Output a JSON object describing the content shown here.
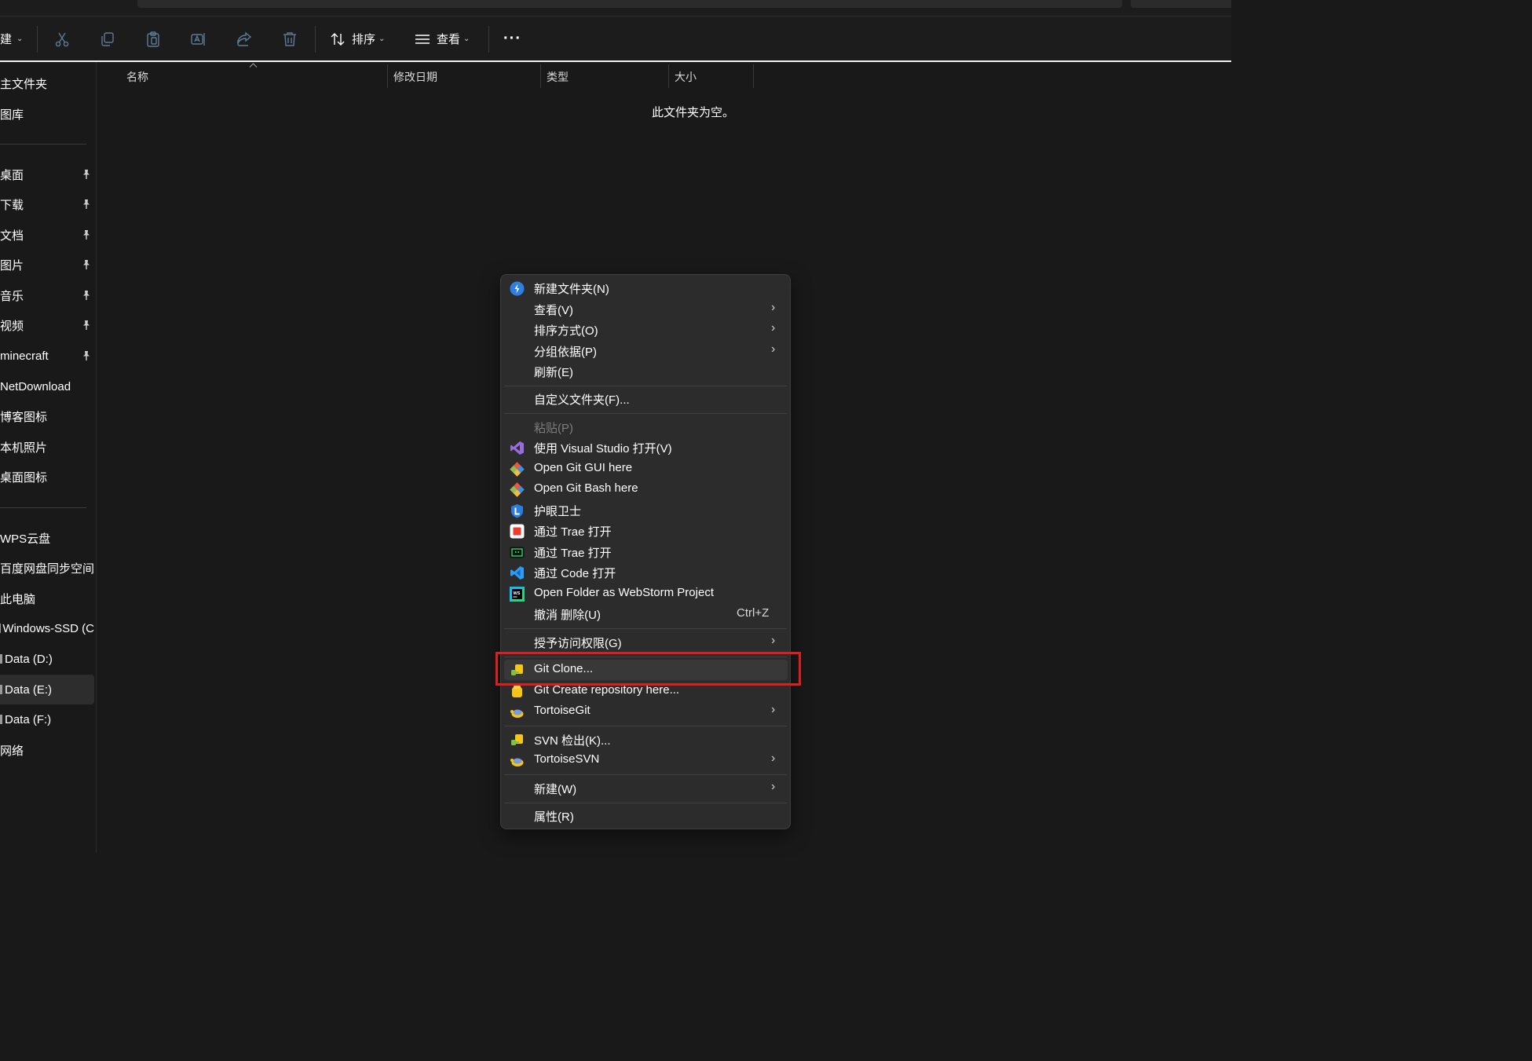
{
  "toolbar": {
    "new_label": "建",
    "sort_label": "排序",
    "view_label": "查看",
    "more_label": "···"
  },
  "columns": [
    "名称",
    "修改日期",
    "类型",
    "大小"
  ],
  "empty_message": "此文件夹为空。",
  "sidebar": {
    "top_items": [
      "主文件夹",
      "图库"
    ],
    "quick_access": [
      {
        "label": "桌面",
        "pinned": true
      },
      {
        "label": "下载",
        "pinned": true
      },
      {
        "label": "文档",
        "pinned": true
      },
      {
        "label": "图片",
        "pinned": true
      },
      {
        "label": "音乐",
        "pinned": true
      },
      {
        "label": "视频",
        "pinned": true
      },
      {
        "label": "minecraft",
        "pinned": true
      },
      {
        "label": "NetDownload",
        "pinned": false
      },
      {
        "label": "博客图标",
        "pinned": false
      },
      {
        "label": "本机照片",
        "pinned": false
      },
      {
        "label": "桌面图标",
        "pinned": false
      }
    ],
    "drives": [
      {
        "label": "WPS云盘",
        "selected": false
      },
      {
        "label": "百度网盘同步空间",
        "selected": false
      },
      {
        "label": "此电脑",
        "selected": false
      },
      {
        "label": "Windows-SSD (C",
        "selected": false
      },
      {
        "label": "Data (D:)",
        "selected": false
      },
      {
        "label": "Data (E:)",
        "selected": true
      },
      {
        "label": "Data (F:)",
        "selected": false
      },
      {
        "label": "网络",
        "selected": false
      }
    ]
  },
  "context_menu": {
    "items": [
      {
        "label": "新建文件夹(N)",
        "icon": "new-folder-icon"
      },
      {
        "label": "查看(V)",
        "submenu": true
      },
      {
        "label": "排序方式(O)",
        "submenu": true
      },
      {
        "label": "分组依据(P)",
        "submenu": true
      },
      {
        "label": "刷新(E)"
      },
      {
        "label": "自定义文件夹(F)..."
      },
      {
        "label": "粘贴(P)",
        "disabled": true
      },
      {
        "label": "使用 Visual Studio 打开(V)",
        "icon": "visual-studio-icon"
      },
      {
        "label": "Open Git GUI here",
        "icon": "git-icon"
      },
      {
        "label": "Open Git Bash here",
        "icon": "git-icon"
      },
      {
        "label": "护眼卫士",
        "icon": "eye-guard-icon"
      },
      {
        "label": "通过 Trae 打开",
        "icon": "trae-icon"
      },
      {
        "label": "通过 Trae 打开",
        "icon": "trae-cn-icon"
      },
      {
        "label": "通过 Code 打开",
        "icon": "vscode-icon"
      },
      {
        "label": "Open Folder as WebStorm Project",
        "icon": "webstorm-icon"
      },
      {
        "label": "撤消 删除(U)",
        "shortcut": "Ctrl+Z"
      },
      {
        "label": "授予访问权限(G)",
        "submenu": true
      },
      {
        "label": "Git Clone...",
        "icon": "tortoisegit-clone-icon",
        "hover": true
      },
      {
        "label": "Git Create repository here...",
        "icon": "tortoisegit-repo-icon"
      },
      {
        "label": "TortoiseGit",
        "icon": "tortoisegit-icon",
        "submenu": true
      },
      {
        "label": "SVN 检出(K)...",
        "icon": "svn-checkout-icon"
      },
      {
        "label": "TortoiseSVN",
        "icon": "tortoisesvn-icon",
        "submenu": true
      },
      {
        "label": "新建(W)",
        "submenu": true
      },
      {
        "label": "属性(R)"
      }
    ]
  },
  "colors": {
    "background": "#191919",
    "menu_background": "#2c2c2c",
    "highlight_box": "#dd1e1e",
    "disabled_icon": "#5d7b9a"
  }
}
